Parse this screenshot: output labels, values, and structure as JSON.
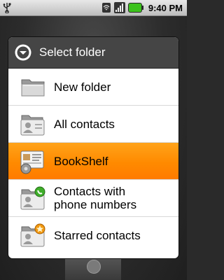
{
  "status_bar": {
    "time": "9:40 PM",
    "icons": [
      "usb-icon",
      "wifi-icon",
      "signal-icon",
      "battery-icon"
    ],
    "battery_color": "#3cc21c"
  },
  "dialog": {
    "title": "Select folder",
    "header_icon": "chevron-down-circle-icon",
    "items": [
      {
        "label": "New folder",
        "icon": "folder-icon",
        "selected": false
      },
      {
        "label": "All contacts",
        "icon": "contact-card-icon",
        "selected": false
      },
      {
        "label": "BookShelf",
        "icon": "bookshelf-card-icon",
        "selected": true
      },
      {
        "label": "Contacts with\nphone numbers",
        "icon": "contact-phone-icon",
        "selected": false
      },
      {
        "label": "Starred contacts",
        "icon": "contact-star-icon",
        "selected": false
      }
    ]
  },
  "colors": {
    "selection": "#ff8a00",
    "header_bg": "#454545"
  }
}
